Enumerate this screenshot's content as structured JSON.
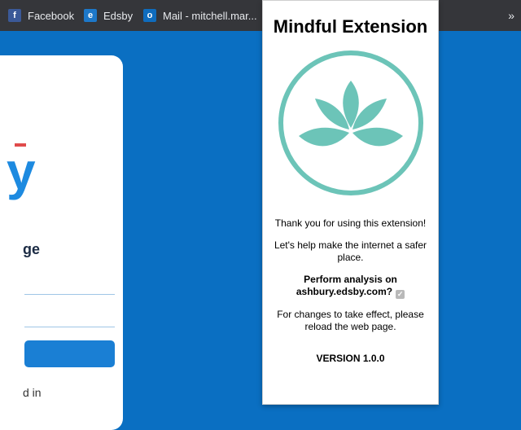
{
  "bookmarks": {
    "items": [
      {
        "label": "Facebook",
        "icon": "facebook-icon"
      },
      {
        "label": "Edsby",
        "icon": "edsby-icon"
      },
      {
        "label": "Mail - mitchell.mar...",
        "icon": "outlook-icon"
      }
    ],
    "overflow": "»"
  },
  "background_page": {
    "logo_fragment": "y",
    "heading_fragment": "ge",
    "footer_fragment": "d in"
  },
  "popup": {
    "title": "Mindful Extension",
    "thanks": "Thank you for using this extension!",
    "mission": "Let's help make the internet a safer place.",
    "analysis_prompt": "Perform analysis on ashbury.edsby.com?",
    "analysis_checked": true,
    "reload_note": "For changes to take effect, please reload the web page.",
    "version": "VERSION 1.0.0",
    "accent_color": "#6cc4b8"
  }
}
